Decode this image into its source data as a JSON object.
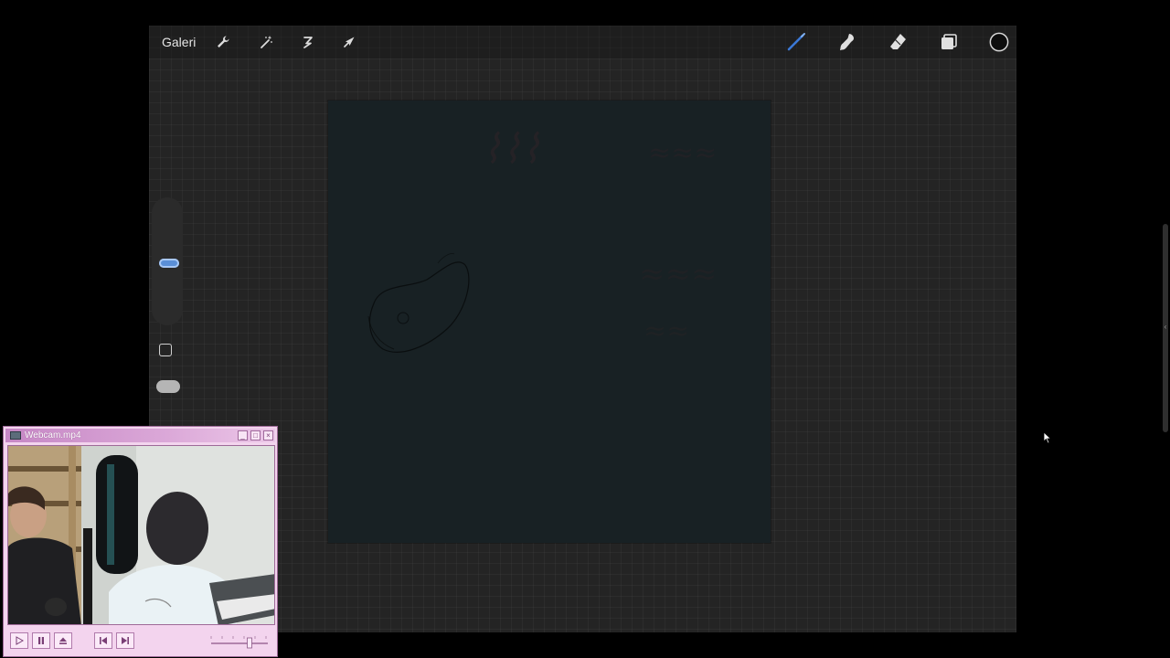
{
  "toolbar": {
    "gallery_label": "Galeri",
    "left_icons": [
      "wrench-icon",
      "magic-wand-icon",
      "selection-icon",
      "transform-arrow-icon"
    ],
    "right_icons": [
      "brush-icon",
      "smudge-icon",
      "eraser-icon",
      "layers-icon",
      "color-circle-icon"
    ],
    "accent_color": "#3b78d6"
  },
  "sidebar": {
    "brush_size_level": 0.48,
    "modify_button": "modify-square-icon",
    "opacity_control": "opacity-pill"
  },
  "canvas": {
    "background_color": "#182124"
  },
  "player": {
    "title": "Webcam.mp4",
    "title_icon": "monitor-icon",
    "window_buttons": [
      "minimize",
      "maximize",
      "close"
    ],
    "window_button_glyphs": {
      "minimize": "_",
      "maximize": "□",
      "close": "×"
    },
    "controls": [
      "play-icon",
      "pause-icon",
      "eject-icon",
      "previous-icon",
      "next-icon"
    ],
    "volume_level": 0.7,
    "theme_color": "#f3d4ee"
  }
}
